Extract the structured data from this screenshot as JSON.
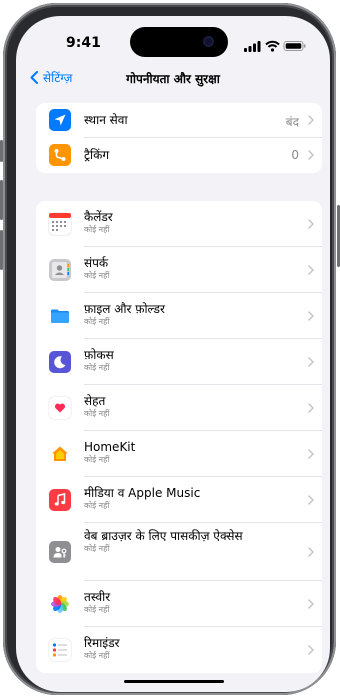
{
  "status": {
    "time": "9:41"
  },
  "nav": {
    "back_label": "सेटिंग्ज़",
    "title": "गोपनीयता और सुरक्षा"
  },
  "group1": [
    {
      "label": "स्थान सेवा",
      "value": "बंद",
      "icon": "location-arrow-icon",
      "color": "#007aff"
    },
    {
      "label": "ट्रैकिंग",
      "value": "0",
      "icon": "tracking-icon",
      "color": "#ff9500"
    }
  ],
  "group2": [
    {
      "label": "कैलेंडर",
      "sub": "कोई नहीं",
      "icon": "calendar-icon"
    },
    {
      "label": "संपर्क",
      "sub": "कोई नहीं",
      "icon": "contacts-icon"
    },
    {
      "label": "फ़ाइल और फ़ोल्डर",
      "sub": "कोई नहीं",
      "icon": "folder-icon"
    },
    {
      "label": "फ़ोकस",
      "sub": "कोई नहीं",
      "icon": "focus-moon-icon"
    },
    {
      "label": "सेहत",
      "sub": "कोई नहीं",
      "icon": "health-heart-icon"
    },
    {
      "label": "HomeKit",
      "sub": "कोई नहीं",
      "icon": "homekit-icon"
    },
    {
      "label": "मीडिया व Apple Music",
      "sub": "कोई नहीं",
      "icon": "music-icon"
    },
    {
      "label": "वेब ब्राउज़र के लिए पासकीज़ ऐक्सेस",
      "sub": "कोई नहीं",
      "icon": "passkey-icon"
    },
    {
      "label": "तस्वीर",
      "sub": "कोई नहीं",
      "icon": "photos-icon"
    },
    {
      "label": "रिमाइंडर",
      "sub": "कोई नहीं",
      "icon": "reminders-icon"
    }
  ]
}
